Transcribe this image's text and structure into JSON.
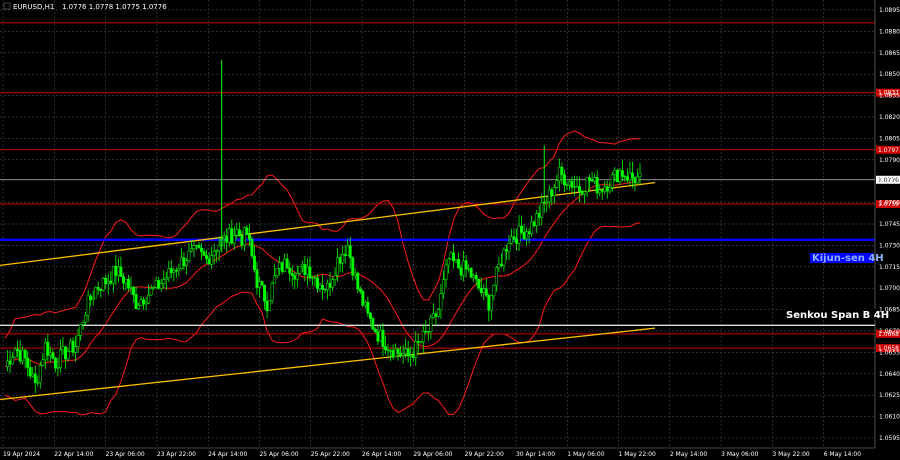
{
  "header": {
    "symbol_label": "EURUSD,H1",
    "ohlc": "1.0776 1.0778 1.0775 1.0776"
  },
  "colors": {
    "background": "#000000",
    "grid": "#5a5a5a",
    "bull": "#00ff00",
    "bear": "#00ff00",
    "level": "#cc0000",
    "kijun": "#0000ff",
    "trend": "#ffc000",
    "bollinger": "#ff1a1a",
    "price_line": "#c0c0c0",
    "label_red_bg": "#cc0000",
    "label_blue_bg": "#0000ff"
  },
  "annotations": {
    "kijun": "Kijun-sen 4H",
    "senkou": "Senkou Span B 4H"
  },
  "chart_data": {
    "type": "candlestick",
    "title": "",
    "grid": true,
    "y_ticks": [
      "1.0895",
      "1.0880",
      "1.0865",
      "1.0850",
      "1.0835",
      "1.0820",
      "1.0805",
      "1.0790",
      "1.0776",
      "1.0760",
      "1.0745",
      "1.0730",
      "1.0715",
      "1.0700",
      "1.0685",
      "1.0670",
      "1.0655",
      "1.0640",
      "1.0625",
      "1.0610",
      "1.0595"
    ],
    "ylim": [
      1.0588,
      1.0902
    ],
    "x_ticks": [
      "19 Apr 2024",
      "22 Apr 14:00",
      "23 Apr 06:00",
      "23 Apr 22:00",
      "24 Apr 14:00",
      "25 Apr 06:00",
      "25 Apr 22:00",
      "26 Apr 14:00",
      "29 Apr 06:00",
      "29 Apr 22:00",
      "30 Apr 14:00",
      "1 May 06:00",
      "1 May 22:00",
      "2 May 14:00",
      "3 May 06:00",
      "3 May 22:00",
      "6 May 14:00"
    ],
    "current_price": 1.0776,
    "levels": [
      {
        "price": 1.0886,
        "label": ""
      },
      {
        "price": 1.0837,
        "label": "1.0837"
      },
      {
        "price": 1.0797,
        "label": "1.0797"
      },
      {
        "price": 1.0759,
        "label": "1.0759"
      },
      {
        "price": 1.0668,
        "label": "1.0668"
      },
      {
        "price": 1.0658,
        "label": "1.0658"
      }
    ],
    "kijun_sen": 1.0734,
    "senkou_span_b": 1.0674,
    "trend_lines": [
      {
        "from": [
          "19 Apr 2024",
          1.0716
        ],
        "to": [
          "6 May 14:00",
          1.0774
        ]
      },
      {
        "from": [
          "19 Apr 2024",
          1.0622
        ],
        "to": [
          "6 May 14:00",
          1.0672
        ]
      }
    ],
    "close_path": [
      [
        0,
        1.0645
      ],
      [
        2,
        1.0658
      ],
      [
        4,
        1.065
      ],
      [
        6,
        1.0632
      ],
      [
        8,
        1.066
      ],
      [
        10,
        1.0648
      ],
      [
        12,
        1.0655
      ],
      [
        14,
        1.066
      ],
      [
        16,
        1.0685
      ],
      [
        18,
        1.07
      ],
      [
        20,
        1.0705
      ],
      [
        22,
        1.0712
      ],
      [
        24,
        1.0705
      ],
      [
        26,
        1.069
      ],
      [
        28,
        1.0695
      ],
      [
        30,
        1.07
      ],
      [
        32,
        1.0708
      ],
      [
        34,
        1.0715
      ],
      [
        36,
        1.0722
      ],
      [
        38,
        1.0725
      ],
      [
        40,
        1.072
      ],
      [
        42,
        1.073
      ],
      [
        44,
        1.0735
      ],
      [
        46,
        1.074
      ],
      [
        47,
        1.0735
      ],
      [
        48,
        1.0738
      ],
      [
        50,
        1.0705
      ],
      [
        52,
        1.069
      ],
      [
        54,
        1.0712
      ],
      [
        56,
        1.0718
      ],
      [
        58,
        1.071
      ],
      [
        60,
        1.0715
      ],
      [
        62,
        1.0705
      ],
      [
        64,
        1.07
      ],
      [
        66,
        1.072
      ],
      [
        68,
        1.073
      ],
      [
        70,
        1.07
      ],
      [
        72,
        1.068
      ],
      [
        74,
        1.0668
      ],
      [
        76,
        1.066
      ],
      [
        78,
        1.0655
      ],
      [
        80,
        1.0652
      ],
      [
        82,
        1.066
      ],
      [
        84,
        1.067
      ],
      [
        86,
        1.0685
      ],
      [
        88,
        1.072
      ],
      [
        90,
        1.0715
      ],
      [
        92,
        1.0712
      ],
      [
        94,
        1.07
      ],
      [
        96,
        1.069
      ],
      [
        98,
        1.0715
      ],
      [
        100,
        1.0735
      ],
      [
        102,
        1.0738
      ],
      [
        104,
        1.0742
      ],
      [
        106,
        1.0752
      ],
      [
        108,
        1.0765
      ],
      [
        110,
        1.078
      ],
      [
        112,
        1.0775
      ],
      [
        114,
        1.077
      ],
      [
        116,
        1.0776
      ],
      [
        118,
        1.077
      ],
      [
        120,
        1.0775
      ],
      [
        122,
        1.0782
      ],
      [
        124,
        1.0778
      ],
      [
        126,
        1.0776
      ]
    ],
    "spikes": [
      {
        "t": 43,
        "high": 1.086,
        "low": 1.0725
      },
      {
        "t": 107,
        "high": 1.08,
        "low": 1.076
      }
    ],
    "t_max": 126
  }
}
